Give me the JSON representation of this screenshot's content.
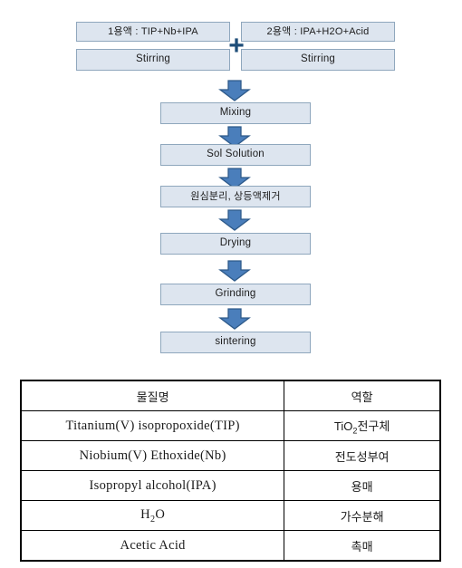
{
  "flowchart": {
    "solution1": {
      "title": "1용액 : TIP+Nb+IPA",
      "step": "Stirring"
    },
    "solution2": {
      "title": "2용액 : IPA+H2O+Acid",
      "step": "Stirring"
    },
    "combiner": "+",
    "steps": [
      {
        "label": "Mixing"
      },
      {
        "label": "Sol Solution"
      },
      {
        "label": "원심분리, 상등액제거"
      },
      {
        "label": "Drying"
      },
      {
        "label": "Grinding"
      },
      {
        "label": "sintering"
      }
    ],
    "arrow_icon": "down-block-arrow-icon",
    "colors": {
      "box_fill": "#dde5ef",
      "box_border": "#8fa7bd",
      "arrow_fill": "#4a7ebb",
      "arrow_border": "#2e5a8a",
      "plus": "#1f4e79"
    }
  },
  "table": {
    "headers": [
      "물질명",
      "역할"
    ],
    "rows": [
      {
        "name": "Titanium(V) isopropoxide(TIP)",
        "name_plain": "Titanium(V) isopropoxide(TIP)",
        "role": "TiO2전구체"
      },
      {
        "name": "Niobium(V) Ethoxide(Nb)",
        "name_plain": "Niobium(V) Ethoxide(Nb)",
        "role": "전도성부여"
      },
      {
        "name": "Isopropyl alcohol(IPA)",
        "name_plain": "Isopropyl alcohol(IPA)",
        "role": "용매"
      },
      {
        "name": "H2O",
        "name_plain": "H2O",
        "role": "가수분해"
      },
      {
        "name": "Acetic Acid",
        "name_plain": "Acetic Acid",
        "role": "촉매"
      }
    ]
  }
}
